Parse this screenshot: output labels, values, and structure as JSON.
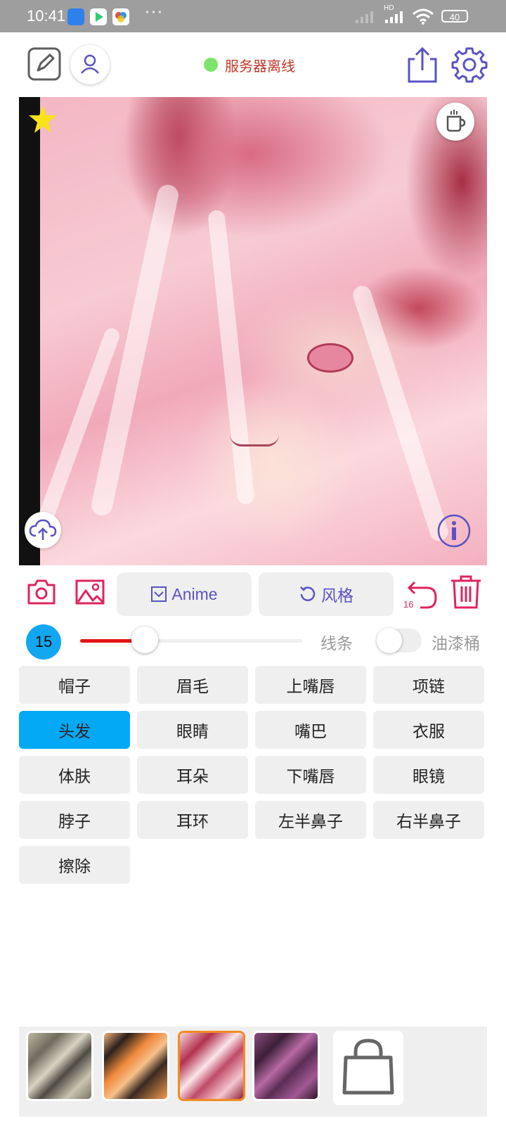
{
  "status_bar": {
    "time": "10:41",
    "dots": "···",
    "network": "HD",
    "battery": "40"
  },
  "header": {
    "server_status": "服务器离线",
    "server_status_color": "#7ee36a",
    "icons": [
      "edit-icon",
      "user-icon",
      "share-icon",
      "settings-icon"
    ]
  },
  "canvas": {
    "icons": [
      "star-icon",
      "coffee-cup-icon",
      "cloud-upload-icon",
      "info-icon"
    ]
  },
  "toolbar": {
    "model_label": "Anime",
    "style_label": "风格",
    "undo_count": "16",
    "icons": [
      "camera-icon",
      "image-icon",
      "checkbox-icon",
      "rotate-icon",
      "undo-icon",
      "trash-icon"
    ]
  },
  "brush": {
    "size": "15",
    "slider_fraction": 0.29,
    "line_label": "线条",
    "bucket_label": "油漆桶",
    "bucket_enabled": false
  },
  "parts": [
    {
      "label": "帽子",
      "selected": false
    },
    {
      "label": "眉毛",
      "selected": false
    },
    {
      "label": "上嘴唇",
      "selected": false
    },
    {
      "label": "项链",
      "selected": false
    },
    {
      "label": "头发",
      "selected": true
    },
    {
      "label": "眼睛",
      "selected": false
    },
    {
      "label": "嘴巴",
      "selected": false
    },
    {
      "label": "衣服",
      "selected": false
    },
    {
      "label": "体肤",
      "selected": false
    },
    {
      "label": "耳朵",
      "selected": false
    },
    {
      "label": "下嘴唇",
      "selected": false
    },
    {
      "label": "眼镜",
      "selected": false
    },
    {
      "label": "脖子",
      "selected": false
    },
    {
      "label": "耳环",
      "selected": false
    },
    {
      "label": "左半鼻子",
      "selected": false
    },
    {
      "label": "右半鼻子",
      "selected": false
    },
    {
      "label": "擦除",
      "selected": false
    }
  ],
  "accent_colors": {
    "primary": "#5a52c4",
    "danger": "#e0245e",
    "selected": "#03a9f4",
    "slider": "#e31414"
  },
  "styles": {
    "selected_index": 2,
    "icons": [
      "shopping-bag-icon"
    ]
  }
}
